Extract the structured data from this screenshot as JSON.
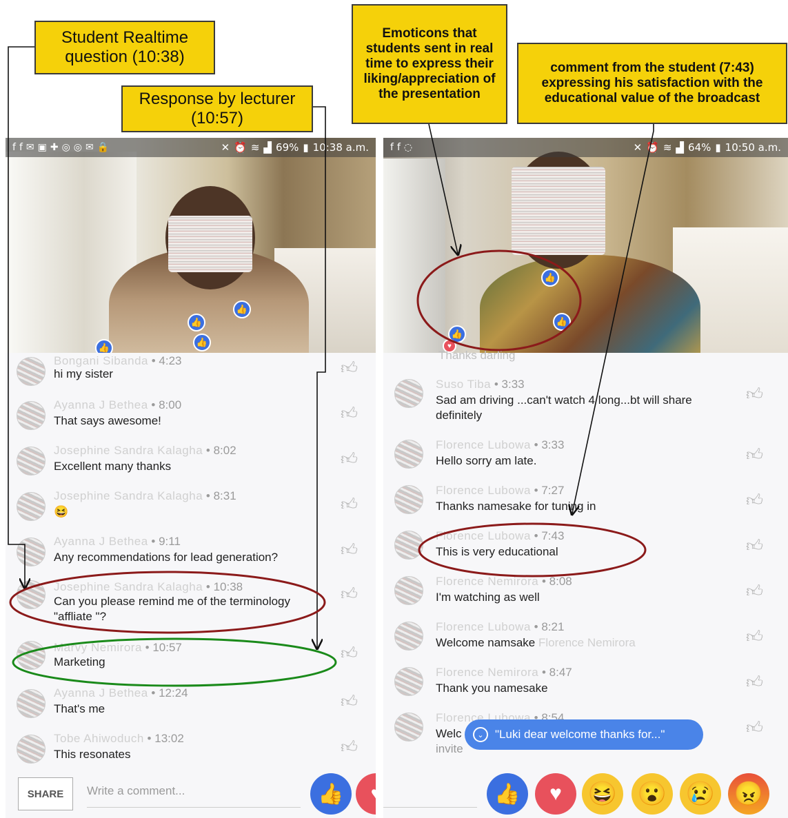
{
  "callouts": {
    "student_question": [
      "Student Realtime",
      "question (10:38)"
    ],
    "lecturer_response": [
      "Response by lecturer",
      "(10:57)"
    ],
    "emoticons": [
      "Emoticons that",
      "students sent in real",
      "time to express their",
      "liking/appreciation of",
      "the presentation"
    ],
    "student_comment": [
      "comment from the student (7:43)",
      "expressing his satisfaction with the",
      "educational value of the broadcast"
    ]
  },
  "left_phone": {
    "status_time": "10:38 a.m.",
    "battery": "69%",
    "comments": [
      {
        "name": "Bongani Sibanda",
        "time": "4:23",
        "text": "hi my sister"
      },
      {
        "name": "Ayanna J Bethea",
        "time": "8:00",
        "text": "That says awesome!"
      },
      {
        "name": "Josephine Sandra Kalagha",
        "time": "8:02",
        "text": "Excellent many thanks"
      },
      {
        "name": "Josephine Sandra Kalagha",
        "time": "8:31",
        "text": "😆"
      },
      {
        "name": "Ayanna J Bethea",
        "time": "9:11",
        "text": "Any recommendations for lead generation?"
      },
      {
        "name": "Josephine Sandra Kalagha",
        "time": "10:38",
        "text": "Can you please remind me of the terminology \"affliate \"?"
      },
      {
        "name": "Marvy Nemirora",
        "time": "10:57",
        "text": "Marketing"
      },
      {
        "name": "Ayanna J Bethea",
        "time": "12:24",
        "text": "That's me"
      },
      {
        "name": "Tobe Ahiwoduch",
        "time": "13:02",
        "text": "This resonates"
      }
    ],
    "share_label": "SHARE",
    "comment_placeholder": "Write a comment..."
  },
  "right_phone": {
    "status_time": "10:50 a.m.",
    "battery": "64%",
    "top_partial": "Thanks darling",
    "comments": [
      {
        "name": "Suso Tiba",
        "time": "3:33",
        "text": "Sad am driving ...can't watch 4 long...bt will share definitely"
      },
      {
        "name": "Florence Lubowa",
        "time": "3:33",
        "text": "Hello sorry am late."
      },
      {
        "name": "Florence Lubowa",
        "time": "7:27",
        "text": "Thanks namesake for tuning in"
      },
      {
        "name": "Florence Lubowa",
        "time": "7:43",
        "text": "This is very educational"
      },
      {
        "name": "Florence Nemirora",
        "time": "8:08",
        "text": "I'm watching as well"
      },
      {
        "name": "Florence Lubowa",
        "time": "8:21",
        "text": "Welcome namsake",
        "tail": "Florence Nemirora"
      },
      {
        "name": "Florence Nemirora",
        "time": "8:47",
        "text": "Thank you namesake"
      },
      {
        "name": "Florence Lubowa",
        "time": "8:54",
        "text": "Welc",
        "text2": "invite"
      }
    ],
    "toast_text": "\"Luki dear welcome thanks for...\"",
    "reactions": [
      "like-icon",
      "love-icon",
      "haha-icon",
      "wow-icon",
      "sad-icon",
      "angry-icon"
    ]
  },
  "colors": {
    "callout_fill": "#f5d10a",
    "facebook_blue": "#3b6fe0",
    "red_ellipse": "#8b1a1a",
    "green_ellipse": "#1a8a1a"
  }
}
